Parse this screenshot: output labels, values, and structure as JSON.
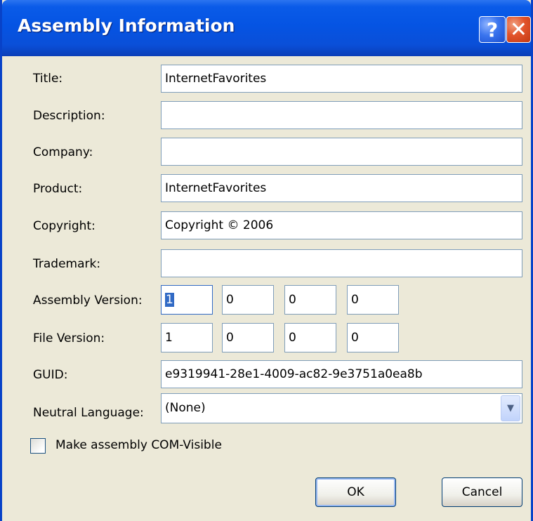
{
  "window": {
    "title": "Assembly Information",
    "help_glyph": "?",
    "close_glyph": "✕",
    "colors": {
      "titlebar": "#0554e3",
      "dialog_bg": "#ece9d8",
      "field_border": "#7f9db9",
      "selection": "#316ac5"
    }
  },
  "fields": {
    "title": {
      "label": "Title:",
      "value": "InternetFavorites"
    },
    "description": {
      "label": "Description:",
      "value": ""
    },
    "company": {
      "label": "Company:",
      "value": ""
    },
    "product": {
      "label": "Product:",
      "value": "InternetFavorites"
    },
    "copyright": {
      "label": "Copyright:",
      "value": "Copyright ©  2006"
    },
    "trademark": {
      "label": "Trademark:",
      "value": ""
    },
    "assembly_version": {
      "label": "Assembly Version:",
      "parts": [
        "1",
        "0",
        "0",
        "0"
      ]
    },
    "file_version": {
      "label": "File Version:",
      "parts": [
        "1",
        "0",
        "0",
        "0"
      ]
    },
    "guid": {
      "label": "GUID:",
      "value": "e9319941-28e1-4009-ac82-9e3751a0ea8b"
    },
    "neutral_language": {
      "label": "Neutral Language:",
      "value": "(None)",
      "icon": "chevron-down-icon"
    }
  },
  "com_visible": {
    "label": "Make assembly COM-Visible",
    "checked": false
  },
  "buttons": {
    "ok": "OK",
    "cancel": "Cancel"
  }
}
